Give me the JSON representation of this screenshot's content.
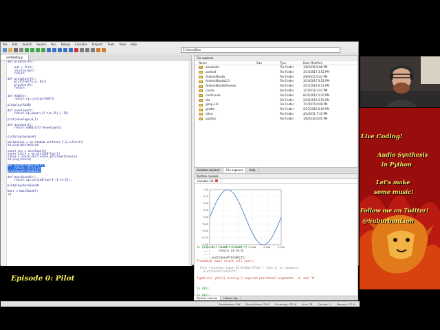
{
  "ide": {
    "menu": [
      "File",
      "Edit",
      "Search",
      "Source",
      "Run",
      "Debug",
      "Consoles",
      "Projects",
      "Tools",
      "View",
      "Help"
    ],
    "path": "C:\\Users\\Dan",
    "editor_tab": "untitled0.py",
    "code_lines": [
      {
        "n": "26",
        "t": "def playfun(fn):",
        "hl": false
      },
      {
        "n": "27",
        "t": "",
        "hl": false
      },
      {
        "n": "28",
        "t": "    out = fn(t)",
        "hl": false
      },
      {
        "n": "29",
        "t": "    sd.play(out)",
        "hl": false
      },
      {
        "n": "30",
        "t": "    return",
        "hl": false
      },
      {
        "n": "31",
        "t": "",
        "hl": false
      },
      {
        "n": "32",
        "t": "def plotplay(fn):",
        "hl": false
      },
      {
        "n": "33",
        "t": "    plot(fun(fn,a,.01))",
        "hl": false
      },
      {
        "n": "34",
        "t": "    playfun(fn)",
        "hl": false
      },
      {
        "n": "35",
        "t": "    return",
        "hl": false
      },
      {
        "n": "36",
        "t": "",
        "hl": false
      },
      {
        "n": "37",
        "t": "",
        "hl": false
      },
      {
        "n": "38",
        "t": "def A440(t):",
        "hl": false
      },
      {
        "n": "39",
        "t": "    return np.sin(tau*440*t)",
        "hl": false
      },
      {
        "n": "40",
        "t": "",
        "hl": false
      },
      {
        "n": "41",
        "t": "plotplay(A440)",
        "hl": false
      },
      {
        "n": "42",
        "t": "",
        "hl": false
      },
      {
        "n": "43",
        "t": "def envelope(t):",
        "hl": false
      },
      {
        "n": "44",
        "t": "    return np.power((1-t/%.25),(.15)",
        "hl": false
      },
      {
        "n": "45",
        "t": "",
        "hl": false
      },
      {
        "n": "46",
        "t": "plot(envelope,0,1)",
        "hl": false
      },
      {
        "n": "47",
        "t": "",
        "hl": false
      },
      {
        "n": "48",
        "t": "def mysound(t):",
        "hl": false
      },
      {
        "n": "49",
        "t": "    return A440(t/2)*envelope(t)",
        "hl": false
      },
      {
        "n": "50",
        "t": "",
        "hl": false
      },
      {
        "n": "51",
        "t": "",
        "hl": false
      },
      {
        "n": "52",
        "t": "plotplay(mysound)",
        "hl": false
      },
      {
        "n": "53",
        "t": "",
        "hl": false
      },
      {
        "n": "54",
        "t": "whitenoise = np.random.uniform(-1,1,s=len(t))",
        "hl": false
      },
      {
        "n": "55",
        "t": "sd.play(whitenoise)",
        "hl": false
      },
      {
        "n": "56",
        "t": "",
        "hl": false
      },
      {
        "n": "57",
        "t": "snare_env = envelope(t)",
        "hl": false
      },
      {
        "n": "58",
        "t": "snare_pitch = np.sin(220*tau*t)",
        "hl": false
      },
      {
        "n": "59",
        "t": "snare = snare_env*(snare_pitch+whitenoise",
        "hl": false
      },
      {
        "n": "60",
        "t": "sd.play(snare)",
        "hl": false
      },
      {
        "n": "61",
        "t": "",
        "hl": false
      },
      {
        "n": "62",
        "t": "def bassPitchShift(t):",
        "hl": true
      },
      {
        "n": "63",
        "t": "    return (1-t)%.5)",
        "hl": true
      },
      {
        "n": "64",
        "t": "plot(bassPitchShift)",
        "hl": true
      },
      {
        "n": "65",
        "t": "",
        "hl": false
      },
      {
        "n": "66",
        "t": "def bassSound(t):",
        "hl": false
      },
      {
        "n": "67",
        "t": "    return np.sin(110*tau*t*(1-t%.5));",
        "hl": false
      },
      {
        "n": "68",
        "t": "",
        "hl": false
      },
      {
        "n": "69",
        "t": "plotplay(bassSound)",
        "hl": false
      },
      {
        "n": "70",
        "t": "",
        "hl": false
      },
      {
        "n": "71",
        "t": "bass = bassSound()",
        "hl": false
      },
      {
        "n": "72",
        "t": "sd.",
        "hl": false
      }
    ]
  },
  "explorer": {
    "title": "File explorer",
    "headers": [
      "Name",
      "Size",
      "Type",
      "Date Modified"
    ],
    "rows": [
      {
        "name": ".anaconda",
        "size": "",
        "type": "File Folder",
        "date": "1/6/2016 6:06 PM"
      },
      {
        "name": ".android",
        "size": "",
        "type": "File Folder",
        "date": "3/14/2017 3:52 PM"
      },
      {
        "name": ".AndroidStudio",
        "size": "",
        "type": "File Folder",
        "date": "2/8/2015 6:42 PM"
      },
      {
        "name": ".AndroidStudio2.3",
        "size": "",
        "type": "File Folder",
        "date": "3/14/2017 3:51 PM"
      },
      {
        "name": ".AndroidStudioPreview",
        "size": "",
        "type": "File Folder",
        "date": "2/27/2016 6:11 PM"
      },
      {
        "name": ".conda",
        "size": "",
        "type": "File Folder",
        "date": "1/7/2018 3:07 PM"
      },
      {
        "name": ".continuum",
        "size": "",
        "type": "File Folder",
        "date": "8/10/2015 5:20 PM"
      },
      {
        "name": ".dia",
        "size": "",
        "type": "File Folder",
        "date": "2/26/2016 5:55 PM"
      },
      {
        "name": ".gimp-2.8",
        "size": "",
        "type": "File Folder",
        "date": "7/7/2015 6:06 PM"
      },
      {
        "name": ".gradle",
        "size": "",
        "type": "File Folder",
        "date": "2/27/2016 6:00 PM"
      },
      {
        "name": ".idlerc",
        "size": "",
        "type": "File Folder",
        "date": "4/1/2011 7:15 PM"
      },
      {
        "name": ".ipython",
        "size": "",
        "type": "File Folder",
        "date": "1/6/2016 6:05 PM"
      }
    ],
    "tabs": [
      "Variable explorer",
      "File explorer",
      "Help"
    ]
  },
  "console": {
    "title": "IPython console",
    "tab": "Console 1/A",
    "lines": [
      {
        "cls": "prompt",
        "t": "In [83]: def bassPitchShift(t):"
      },
      {
        "cls": "",
        "t": "    ...:     return (1-t%.5)"
      },
      {
        "cls": "",
        "t": "    ...:"
      },
      {
        "cls": "",
        "t": "    ...: plot(bassPitchShift)"
      },
      {
        "cls": "err",
        "t": "Traceback (most recent call last):"
      },
      {
        "cls": "",
        "t": ""
      },
      {
        "cls": "grey",
        "t": "  File \"<ipython-input-83-0fe9a1f7fdd>\", line 4, in <module>"
      },
      {
        "cls": "grey",
        "t": "    plot(bassPitchShift)"
      },
      {
        "cls": "",
        "t": ""
      },
      {
        "cls": "err",
        "t": "TypeError: plot() missing 2 required positional arguments: 'a' and 'b'"
      },
      {
        "cls": "",
        "t": ""
      },
      {
        "cls": "",
        "t": ""
      },
      {
        "cls": "prompt",
        "t": "In [84]:"
      },
      {
        "cls": "",
        "t": ""
      },
      {
        "cls": "prompt",
        "t": "In [84]:"
      }
    ],
    "bottom_tabs": [
      "IPython console",
      "History log"
    ]
  },
  "status": {
    "permissions": "Permissions: RW",
    "eol": "End-of-lines: CRLF",
    "encoding": "Encoding: UTF-8",
    "line": "Line: 78",
    "column": "Column: 1",
    "memory": "Memory: 57 %"
  },
  "chart_data": {
    "type": "line",
    "x_ticks": [
      "0.000",
      "0.002",
      "0.004",
      "0.006",
      "0.008",
      "0.010"
    ],
    "y_ticks": [
      "1.00",
      "0.75",
      "0.50",
      "0.25",
      "0.00",
      "−0.25",
      "−0.50",
      "−0.75",
      "−1.00"
    ],
    "xlim": [
      0,
      0.01
    ],
    "ylim": [
      -1,
      1
    ],
    "series": [
      {
        "function": "sin(2*pi*100*x)",
        "color": "#4a7fbd"
      }
    ],
    "grid": true
  },
  "promo": {
    "live": "Live Coding!",
    "audio1": "Audio Synthesis",
    "audio2": "in Python",
    "lets1": "Let's make",
    "lets2": "some music!",
    "follow": "Follow me on Twitter!",
    "handle": "@SuburbanLion"
  },
  "episode": "Episode 0: Pilot"
}
